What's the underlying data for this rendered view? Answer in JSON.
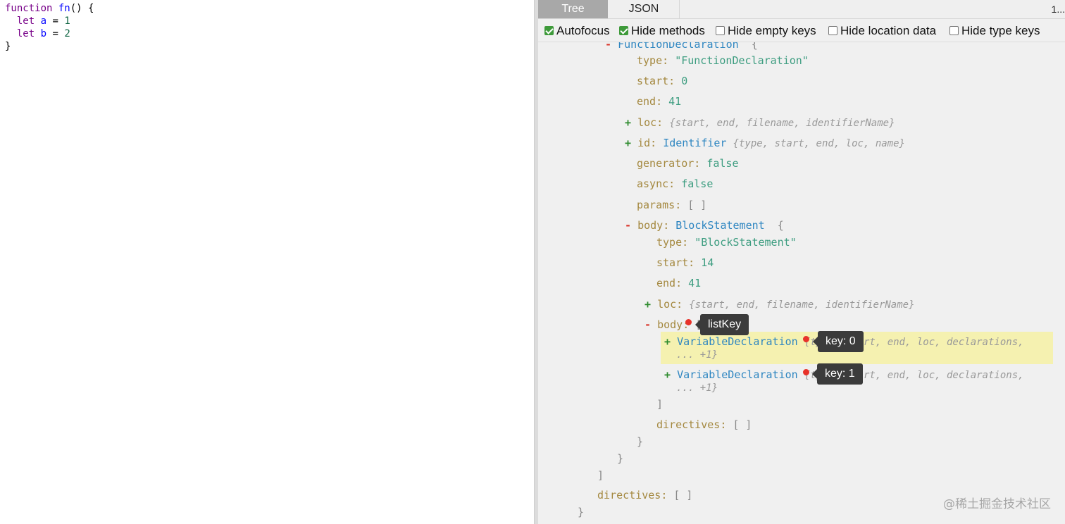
{
  "editor": {
    "line1": {
      "kw": "function",
      "name": "fn",
      "rest": "() {"
    },
    "line2": {
      "kw": "let",
      "name": "a",
      "eq": " = ",
      "val": "1"
    },
    "line3": {
      "kw": "let",
      "name": "b",
      "eq": " = ",
      "val": "2"
    },
    "line4": "}"
  },
  "tabs": {
    "tree": "Tree",
    "json": "JSON",
    "time": "1..."
  },
  "options": {
    "autofocus": {
      "label": "Autofocus",
      "checked": true
    },
    "hide_methods": {
      "label": "Hide methods",
      "checked": true
    },
    "hide_empty": {
      "label": "Hide empty keys",
      "checked": false
    },
    "hide_location": {
      "label": "Hide location data",
      "checked": false
    },
    "hide_type": {
      "label": "Hide type keys",
      "checked": false
    }
  },
  "tree": {
    "fn_decl": {
      "toggle": "-",
      "type": "FunctionDeclaration",
      "brace": "{"
    },
    "type": {
      "key": "type",
      "val": "\"FunctionDeclaration\""
    },
    "start": {
      "key": "start",
      "val": "0"
    },
    "end": {
      "key": "end",
      "val": "41"
    },
    "loc": {
      "toggle": "+",
      "key": "loc",
      "sum": "{start, end, filename, identifierName}"
    },
    "id": {
      "toggle": "+",
      "key": "id",
      "type": "Identifier",
      "sum": "{type, start, end, loc, name}"
    },
    "generator": {
      "key": "generator",
      "val": "false"
    },
    "async": {
      "key": "async",
      "val": "false"
    },
    "params": {
      "key": "params",
      "val": "[ ]"
    },
    "body": {
      "toggle": "-",
      "key": "body",
      "type": "BlockStatement",
      "brace": "{"
    },
    "b_type": {
      "key": "type",
      "val": "\"BlockStatement\""
    },
    "b_start": {
      "key": "start",
      "val": "14"
    },
    "b_end": {
      "key": "end",
      "val": "41"
    },
    "b_loc": {
      "toggle": "+",
      "key": "loc",
      "sum": "{start, end, filename, identifierName}"
    },
    "b_body": {
      "toggle": "-",
      "key": "body",
      "open": "["
    },
    "var1": {
      "toggle": "+",
      "type": "VariableDeclaration",
      "sum1": "{type, start, end, loc, declarations,",
      "sum2": "... +1}"
    },
    "var2": {
      "toggle": "+",
      "type": "VariableDeclaration",
      "sum1": "{type, start, end, loc, declarations,",
      "sum2": "... +1}"
    },
    "close_list": "]",
    "b_directives": {
      "key": "directives",
      "val": "[ ]"
    },
    "close_block": "}",
    "close_fn": "}",
    "close_outer_list": "]",
    "directives": {
      "key": "directives",
      "val": "[ ]"
    },
    "close_program": "}"
  },
  "tooltips": {
    "list_key": "listKey",
    "key0": "key: 0",
    "key1": "key: 1"
  },
  "watermark": "@稀土掘金技术社区"
}
